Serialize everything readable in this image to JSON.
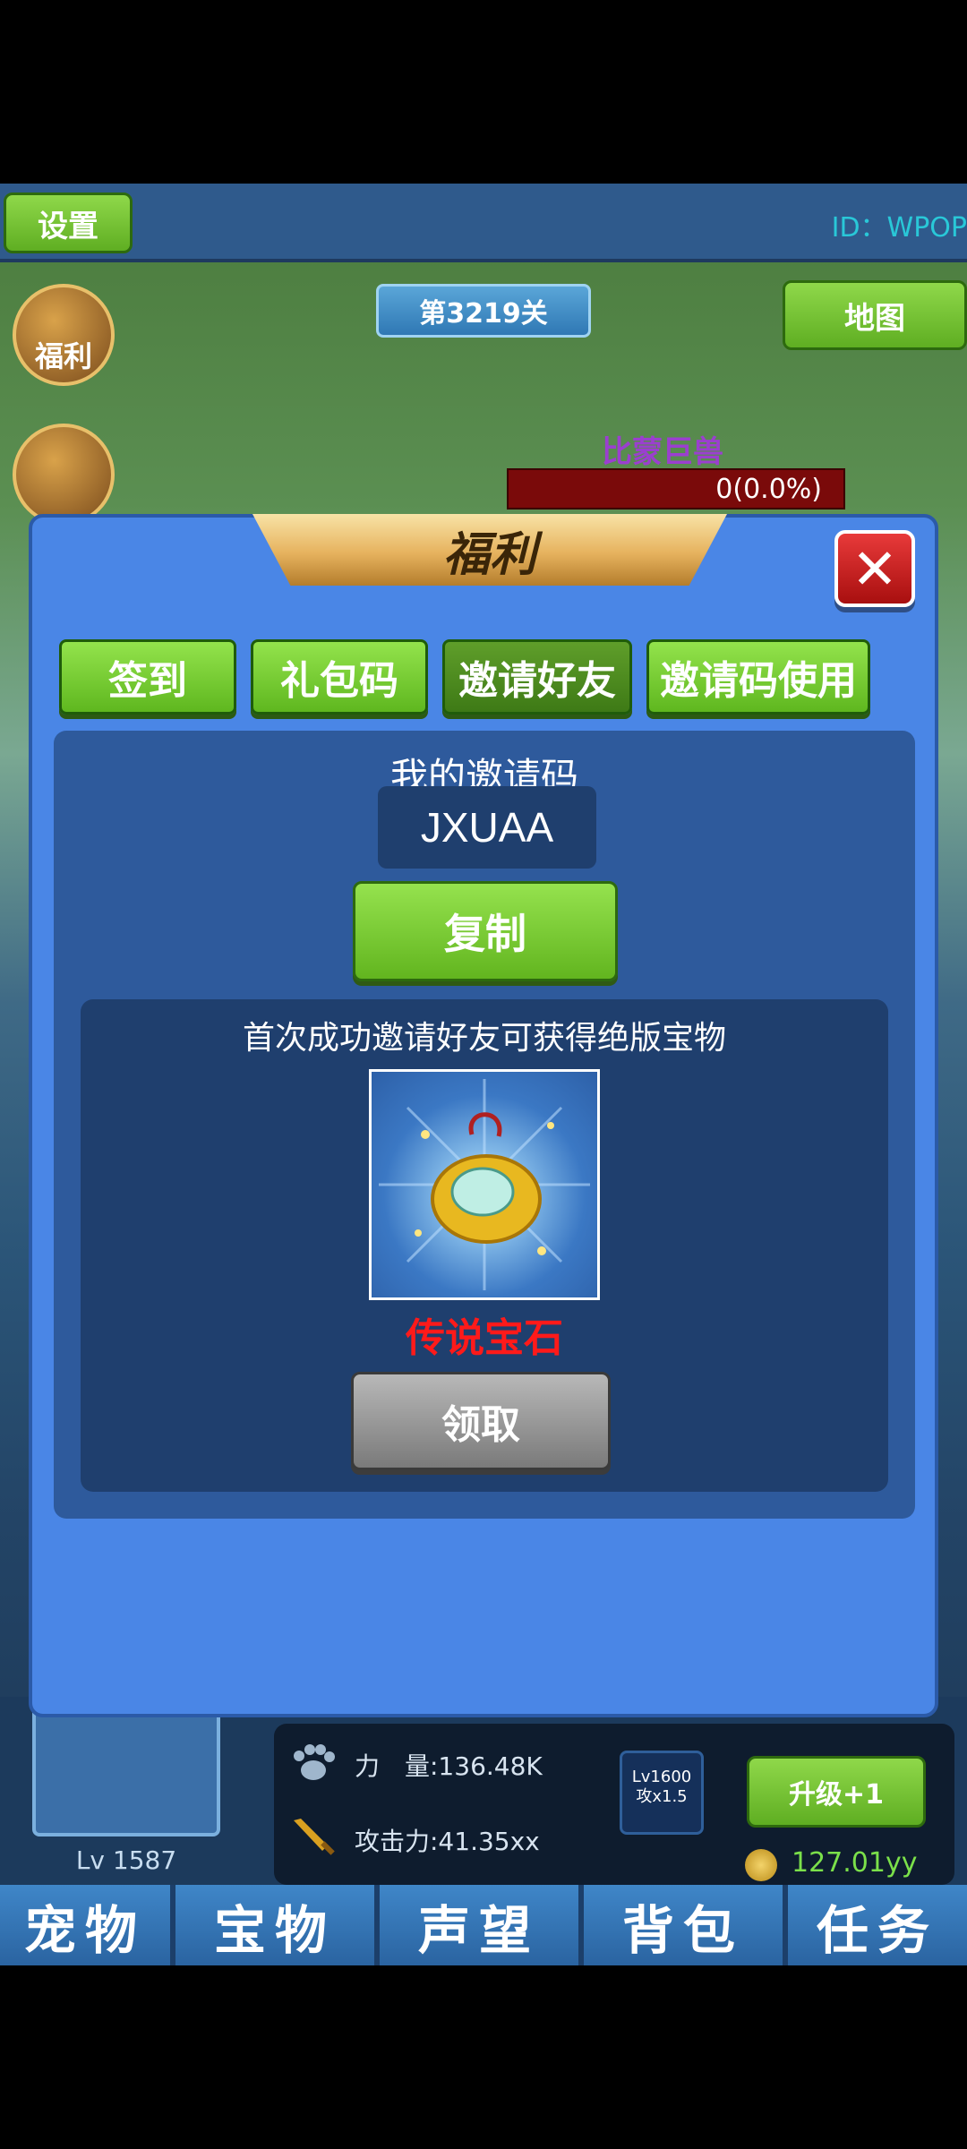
{
  "header": {
    "settings_label": "设置",
    "user_id": "ID：WPOP"
  },
  "stage": {
    "level_label": "第3219关",
    "map_label": "地图"
  },
  "side_menu": {
    "welfare_label": "福利"
  },
  "boss": {
    "name": "比蒙巨兽",
    "hp_text": "0(0.0%)"
  },
  "modal": {
    "title": "福利",
    "tabs": [
      {
        "label": "签到",
        "active": false
      },
      {
        "label": "礼包码",
        "active": false
      },
      {
        "label": "邀请好友",
        "active": true
      },
      {
        "label": "邀请码使用",
        "active": false
      }
    ],
    "my_code_label": "我的邀请码",
    "invite_code": "JXUAA",
    "copy_label": "复制",
    "reward_desc": "首次成功邀请好友可获得绝版宝物",
    "reward_name": "传说宝石",
    "claim_label": "领取"
  },
  "bottom": {
    "pet_level": "Lv 1587",
    "power": "力　量:136.48K",
    "attack": "攻击力:41.35xx",
    "badge_level": "Lv1600",
    "badge_bonus": "攻x1.5",
    "upgrade_label": "升级+1",
    "gold": "127.01yy"
  },
  "nav_tabs": [
    "宠物",
    "宝物",
    "声望",
    "背包",
    "任务"
  ],
  "colors": {
    "modal_bg": "#4a86e6",
    "accent_green": "#7bd237",
    "reward_red": "#ff1a1a"
  }
}
